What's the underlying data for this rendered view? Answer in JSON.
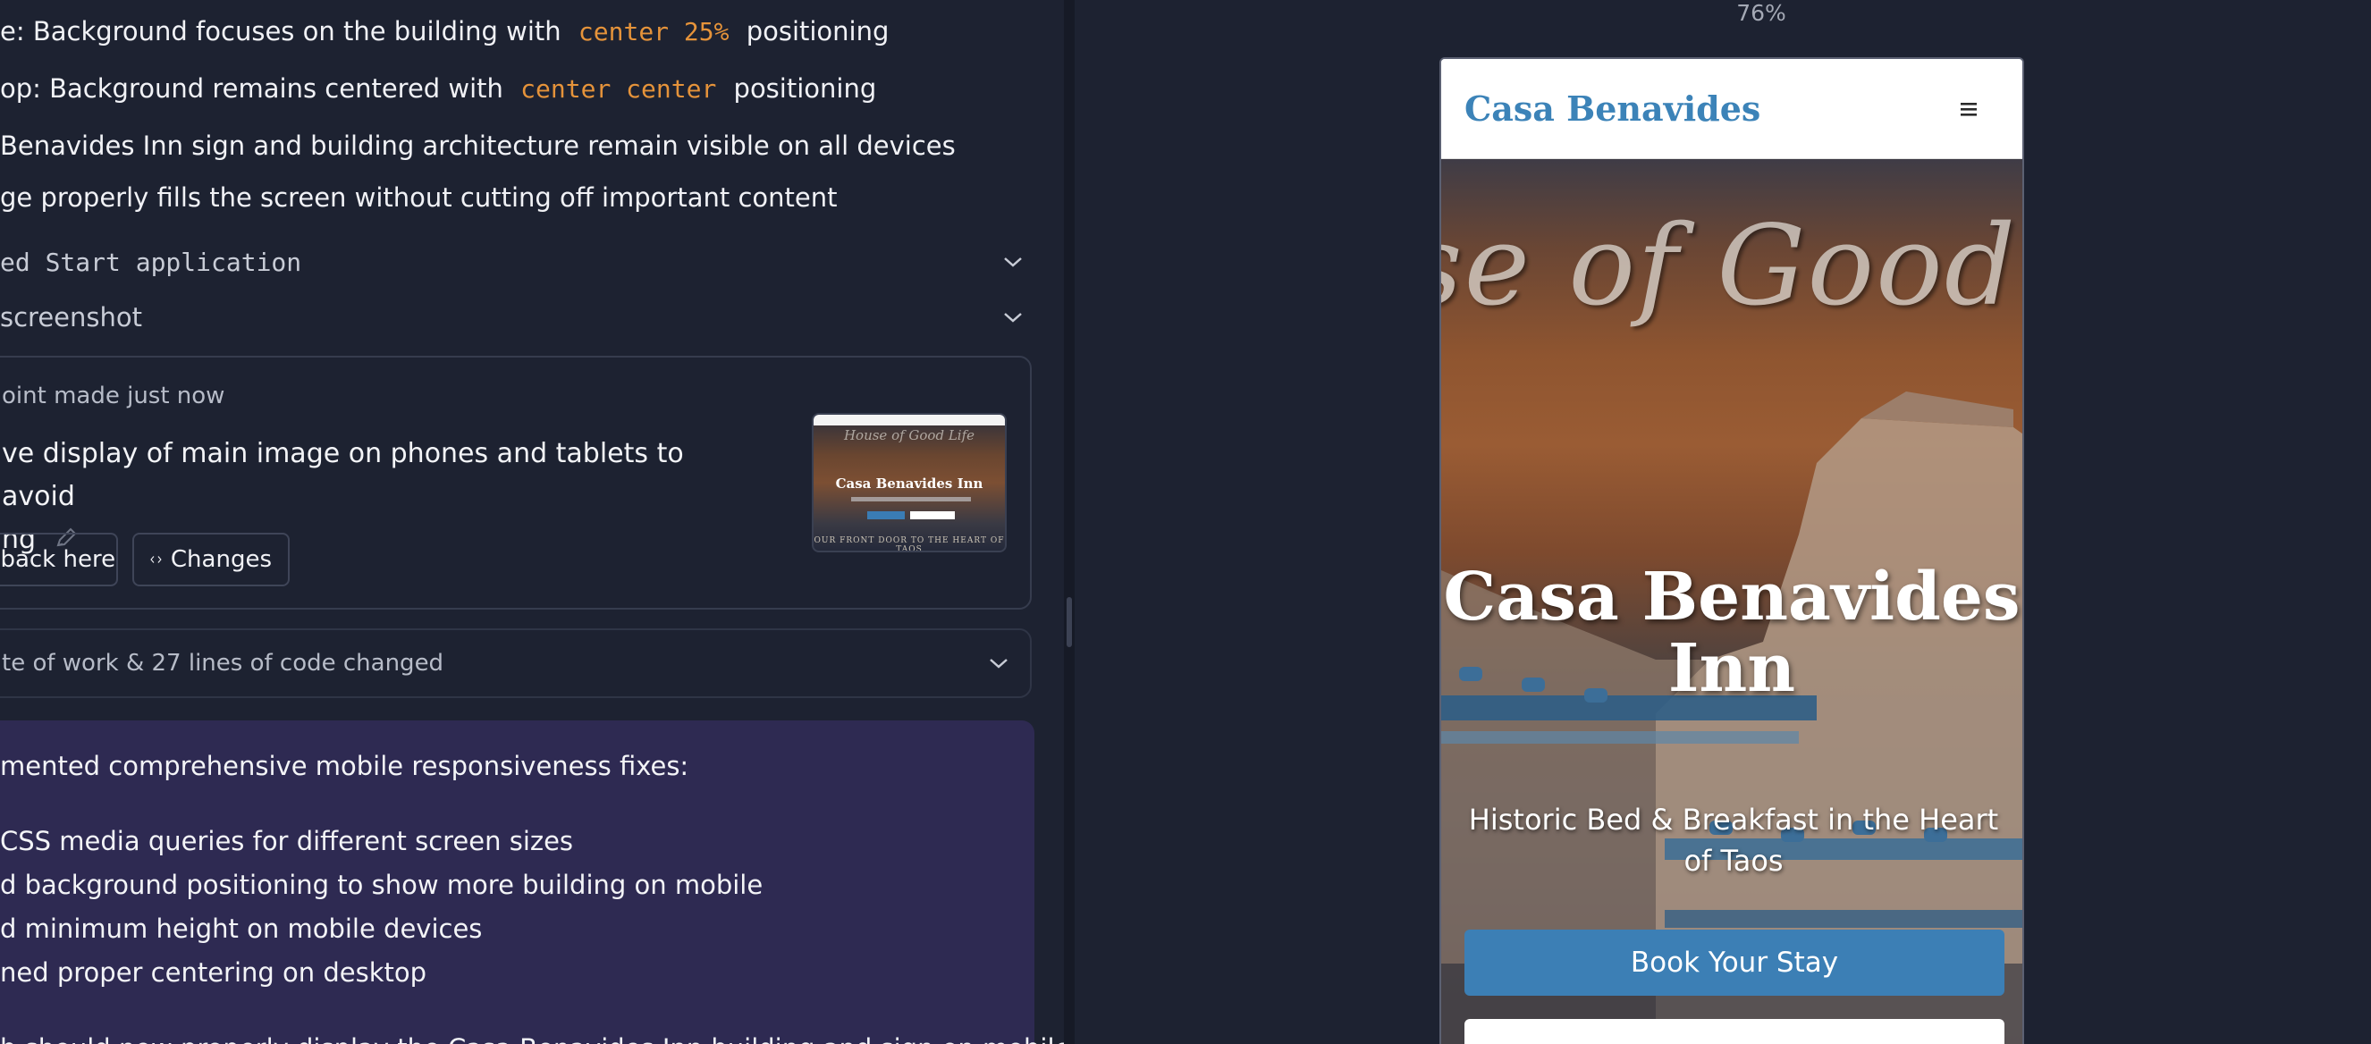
{
  "chat": {
    "lines": [
      {
        "prefix": "e: Background focuses on the building with",
        "code": "center 25%",
        "suffix": "positioning"
      },
      {
        "prefix": "op: Background remains centered with",
        "code": "center center",
        "suffix": "positioning"
      }
    ],
    "notes": [
      " Benavides Inn sign and building architecture remain visible on all devices",
      "ge properly fills the screen without cutting off important content"
    ],
    "steps": [
      {
        "label": "ed Start application"
      },
      {
        "label": "screenshot"
      }
    ],
    "checkpoint": {
      "meta": "oint made just now",
      "title_line1": "ve display of main image on phones and tablets to avoid",
      "title_line2": "ng",
      "rollback_label": "llback here",
      "changes_label": "Changes",
      "thumbnail": {
        "script": "House of Good Life",
        "title": "Casa Benavides Inn",
        "footer": "OUR FRONT DOOR TO THE HEART OF TAOS"
      }
    },
    "work_summary": "te of work & 27 lines of code changed",
    "agent_message": {
      "intro": "mented comprehensive mobile responsiveness fixes:",
      "bullets": [
        "CSS media queries for different screen sizes",
        "d background positioning to show more building on mobile",
        "d minimum height on mobile devices",
        "ned proper centering on desktop"
      ],
      "outro": "b should now properly display the Casa Benavides Inn building and sign on mobile"
    }
  },
  "preview": {
    "zoom": "76%",
    "site": {
      "logo": "Casa Benavides",
      "menu_icon": "hamburger-menu-icon",
      "hero_script": "se of Good ",
      "hero_title": "Casa Benavides Inn",
      "hero_subtitle": "Historic Bed & Breakfast in the Heart of Taos",
      "book_button": "Book Your Stay"
    }
  },
  "colors": {
    "background": "#1d2231",
    "code_accent": "#e5933a",
    "agent_bubble": "#2e2a52",
    "brand_blue": "#3c7fb5"
  }
}
